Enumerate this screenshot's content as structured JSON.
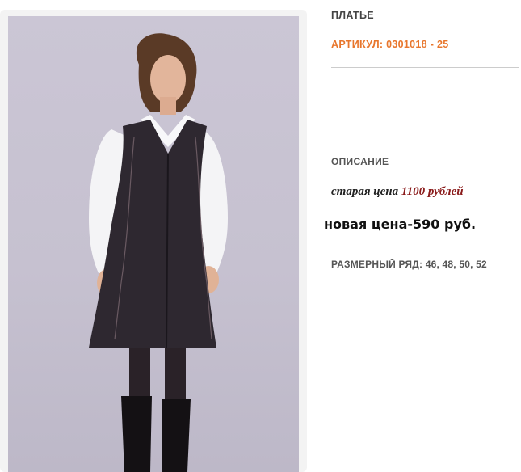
{
  "product": {
    "title": "ПЛАТЬЕ",
    "sku": "АРТИКУЛ: 0301018 - 25",
    "description_heading": "ОПИСАНИЕ",
    "old_price_prefix": "старая цена ",
    "old_price_amount": "1100 рублей",
    "new_price": "новая цена-590 руб.",
    "sizes": "РАЗМЕРНЫЙ РЯД: 46, 48, 50, 52"
  },
  "colors": {
    "accent": "#e8762c",
    "old_price_amount": "#8a1a1a",
    "photo_background": "#c8c3d2",
    "dress": "#2e2830"
  }
}
